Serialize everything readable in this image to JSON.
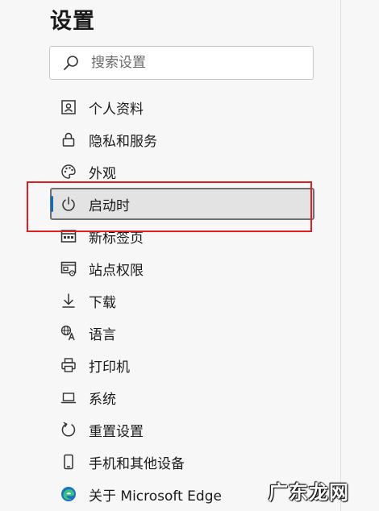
{
  "page": {
    "title": "设置"
  },
  "search": {
    "placeholder": "搜索设置",
    "icon": "search-icon"
  },
  "nav": {
    "items": [
      {
        "label": "个人资料",
        "icon": "profile-icon"
      },
      {
        "label": "隐私和服务",
        "icon": "lock-icon"
      },
      {
        "label": "外观",
        "icon": "palette-icon"
      },
      {
        "label": "启动时",
        "icon": "power-icon",
        "active": true
      },
      {
        "label": "新标签页",
        "icon": "new-tab-icon"
      },
      {
        "label": "站点权限",
        "icon": "site-permissions-icon"
      },
      {
        "label": "下载",
        "icon": "download-icon"
      },
      {
        "label": "语言",
        "icon": "language-icon"
      },
      {
        "label": "打印机",
        "icon": "printer-icon"
      },
      {
        "label": "系统",
        "icon": "system-icon"
      },
      {
        "label": "重置设置",
        "icon": "reset-icon"
      },
      {
        "label": "手机和其他设备",
        "icon": "phone-icon"
      },
      {
        "label": "关于 Microsoft Edge",
        "icon": "edge-logo-icon"
      }
    ]
  },
  "colors": {
    "accent": "#0f6cbd",
    "highlight_box": "#e02020",
    "active_background": "#e3e3e3"
  },
  "watermark": {
    "text": "广东龙网"
  }
}
